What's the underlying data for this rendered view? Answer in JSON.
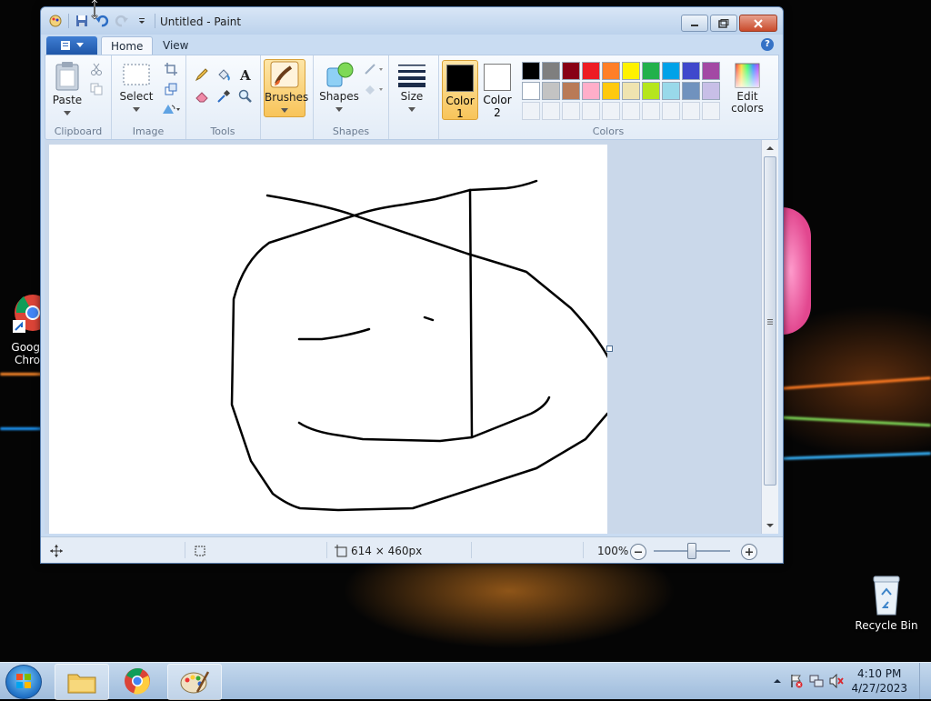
{
  "desktop": {
    "icons": [
      {
        "label": "Google Chrome",
        "label_line1": "Goog",
        "label_line2": "Chro"
      },
      {
        "label": "Recycle Bin"
      }
    ]
  },
  "window": {
    "title": "Untitled - Paint",
    "tabs": [
      {
        "label": "Home",
        "active": true
      },
      {
        "label": "View",
        "active": false
      }
    ],
    "ribbon": {
      "clipboard": {
        "label": "Clipboard",
        "paste": "Paste"
      },
      "image": {
        "label": "Image",
        "select": "Select"
      },
      "tools": {
        "label": "Tools"
      },
      "brushes": {
        "label": "Brushes"
      },
      "shapes": {
        "label": "Shapes",
        "shapes_btn": "Shapes"
      },
      "size": {
        "label": "Size"
      },
      "colors": {
        "label": "Colors",
        "color1_line1": "Color",
        "color1_line2": "1",
        "color2_line1": "Color",
        "color2_line2": "2",
        "edit_line1": "Edit",
        "edit_line2": "colors",
        "color1_value": "#000000",
        "color2_value": "#ffffff",
        "palette_row1": [
          "#000000",
          "#7f7f7f",
          "#880015",
          "#ed1c24",
          "#ff7f27",
          "#fff200",
          "#22b14c",
          "#00a2e8",
          "#3f48cc",
          "#a349a4"
        ],
        "palette_row2": [
          "#ffffff",
          "#c3c3c3",
          "#b97a57",
          "#ffaec9",
          "#ffc90e",
          "#efe4b0",
          "#b5e61d",
          "#99d9ea",
          "#7092be",
          "#c8bfe7"
        ]
      }
    },
    "status": {
      "canvas_size": "614 × 460px",
      "zoom": "100%"
    }
  },
  "taskbar": {
    "time": "4:10 PM",
    "date": "4/27/2023"
  }
}
